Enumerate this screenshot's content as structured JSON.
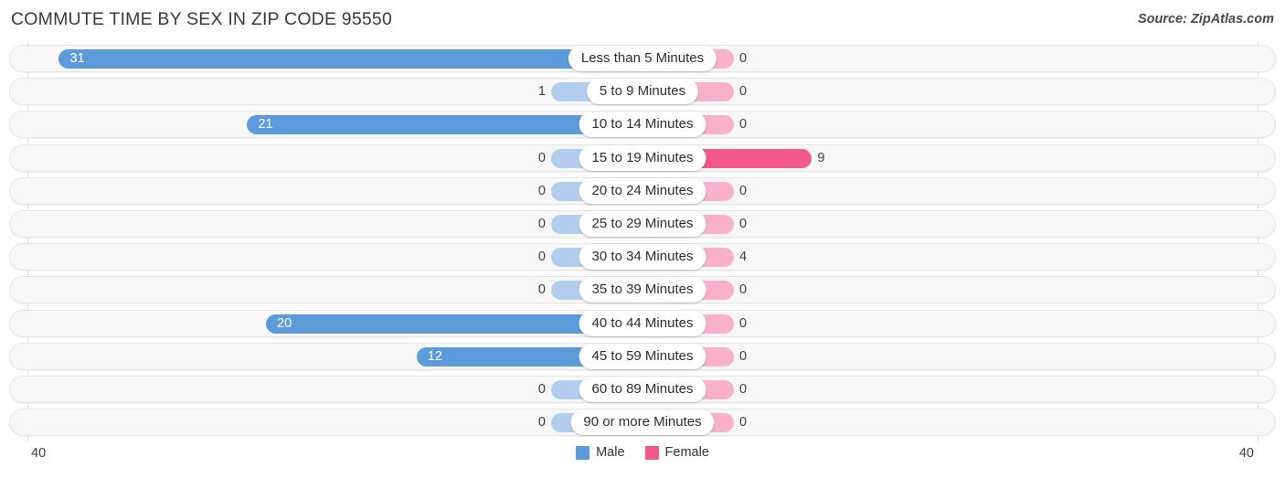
{
  "header": {
    "title": "COMMUTE TIME BY SEX IN ZIP CODE 95550",
    "source": "Source: ZipAtlas.com"
  },
  "legend": {
    "male_label": "Male",
    "female_label": "Female",
    "male_color": "#5b9bd9",
    "female_color": "#f2588c"
  },
  "axis": {
    "left_max": "40",
    "right_max": "40"
  },
  "colors": {
    "male_strong": "#5b9bd9",
    "male_pale": "#b3cdef",
    "female_strong": "#f2588c",
    "female_pale": "#f9b0cb",
    "track": "#f7f7f7",
    "track_border": "#e6e6e6"
  },
  "chart_data": {
    "type": "bar",
    "subtype": "diverging-bar",
    "title": "COMMUTE TIME BY SEX IN ZIP CODE 95550",
    "xlabel": "",
    "ylabel": "",
    "xlim": [
      40,
      40
    ],
    "grid": true,
    "legend_position": "bottom-center",
    "categories": [
      "Less than 5 Minutes",
      "5 to 9 Minutes",
      "10 to 14 Minutes",
      "15 to 19 Minutes",
      "20 to 24 Minutes",
      "25 to 29 Minutes",
      "30 to 34 Minutes",
      "35 to 39 Minutes",
      "40 to 44 Minutes",
      "45 to 59 Minutes",
      "60 to 89 Minutes",
      "90 or more Minutes"
    ],
    "series": [
      {
        "name": "Male",
        "side": "left",
        "color": "#5b9bd9",
        "values": [
          31,
          1,
          21,
          0,
          0,
          0,
          0,
          0,
          20,
          12,
          0,
          0
        ]
      },
      {
        "name": "Female",
        "side": "right",
        "color": "#f2588c",
        "values": [
          0,
          0,
          0,
          9,
          0,
          0,
          4,
          0,
          0,
          0,
          0,
          0
        ]
      }
    ]
  },
  "rows": [
    {
      "label": "Less than 5 Minutes",
      "male": "31",
      "female": "0"
    },
    {
      "label": "5 to 9 Minutes",
      "male": "1",
      "female": "0"
    },
    {
      "label": "10 to 14 Minutes",
      "male": "21",
      "female": "0"
    },
    {
      "label": "15 to 19 Minutes",
      "male": "0",
      "female": "9"
    },
    {
      "label": "20 to 24 Minutes",
      "male": "0",
      "female": "0"
    },
    {
      "label": "25 to 29 Minutes",
      "male": "0",
      "female": "0"
    },
    {
      "label": "30 to 34 Minutes",
      "male": "0",
      "female": "4"
    },
    {
      "label": "35 to 39 Minutes",
      "male": "0",
      "female": "0"
    },
    {
      "label": "40 to 44 Minutes",
      "male": "20",
      "female": "0"
    },
    {
      "label": "45 to 59 Minutes",
      "male": "12",
      "female": "0"
    },
    {
      "label": "60 to 89 Minutes",
      "male": "0",
      "female": "0"
    },
    {
      "label": "90 or more Minutes",
      "male": "0",
      "female": "0"
    }
  ]
}
